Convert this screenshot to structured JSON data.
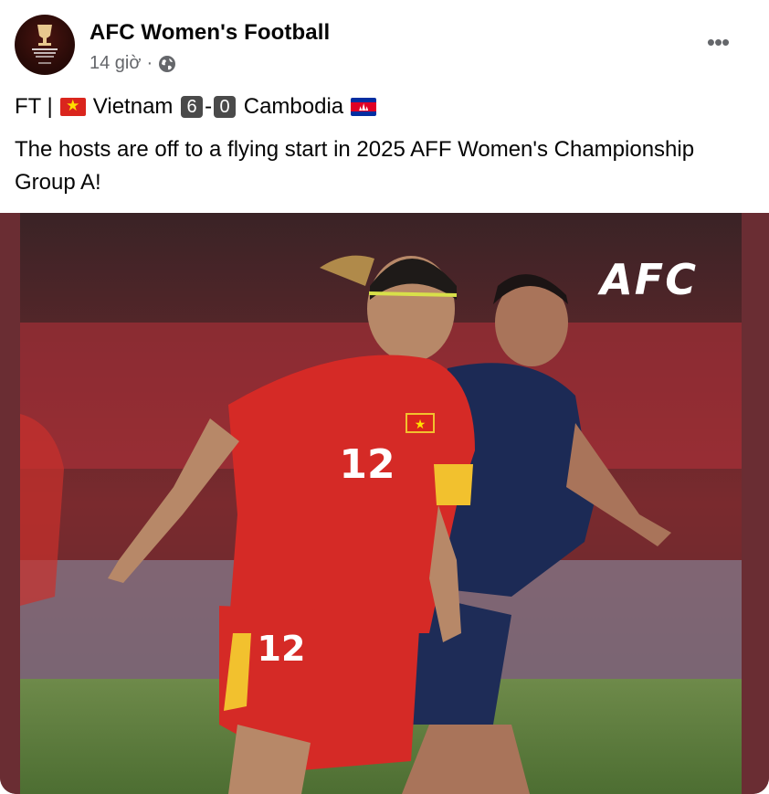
{
  "post": {
    "page_name": "AFC Women's Football",
    "time": "14 giờ",
    "separator": "·",
    "more_label": "•••",
    "score_line": {
      "prefix": "FT |",
      "team_home": "Vietnam",
      "score_home": "6",
      "dash": "-",
      "score_away": "0",
      "team_away": "Cambodia"
    },
    "caption": "The hosts are off to a flying start in 2025 AFF Women's Championship Group A!"
  },
  "photo": {
    "watermark": "AFC",
    "player_number_shirt": "12",
    "player_number_shorts": "12"
  },
  "icons": {
    "avatar": "afc-womens-champions-league-logo",
    "privacy": "globe-icon",
    "more": "more-horizontal-icon",
    "flag_home": "vietnam-flag-icon",
    "flag_away": "cambodia-flag-icon"
  },
  "colors": {
    "text_primary": "#050505",
    "text_secondary": "#65676b",
    "vietnam_red": "#da251d",
    "cambodia_navy": "#1c2a55"
  }
}
